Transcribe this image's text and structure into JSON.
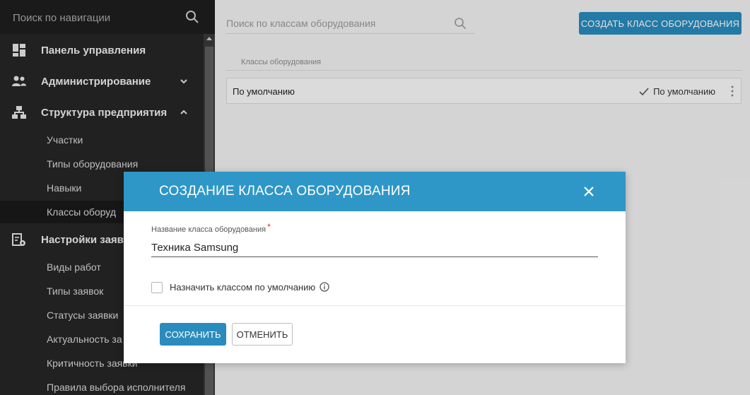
{
  "sidebar": {
    "search_placeholder": "Поиск по навигации",
    "items": [
      {
        "label": "Панель управления",
        "icon": "dashboard-icon"
      },
      {
        "label": "Администрирование",
        "icon": "users-icon",
        "chevron": "down"
      },
      {
        "label": "Структура предприятия",
        "icon": "org-structure-icon",
        "chevron": "up"
      }
    ],
    "structure_sub": [
      "Участки",
      "Типы оборудования",
      "Навыки",
      "Классы оборуд"
    ],
    "settings": {
      "label": "Настройки заяв",
      "icon": "settings-clipboard-icon"
    },
    "settings_sub": [
      "Виды работ",
      "Типы заявок",
      "Статусы заявки",
      "Актуальность за",
      "Критичность заявки",
      "Правила выбора исполнителя"
    ]
  },
  "main": {
    "search_placeholder": "Поиск по классам оборудования",
    "create_button": "СОЗДАТЬ КЛАСС ОБОРУДОВАНИЯ",
    "column_header": "Классы оборудования",
    "rows": [
      {
        "name": "По умолчанию",
        "default_label": "По умолчанию"
      }
    ]
  },
  "modal": {
    "title": "СОЗДАНИЕ КЛАССА ОБОРУДОВАНИЯ",
    "field_label": "Название класса оборудования",
    "required_mark": "*",
    "field_value": "Техника Samsung",
    "checkbox_label": "Назначить классом по умолчанию",
    "checkbox_checked": false,
    "save_button": "СОХРАНИТЬ",
    "cancel_button": "ОТМЕНИТЬ"
  },
  "colors": {
    "sidebar_bg": "#262626",
    "accent": "#2a8bbd",
    "modal_header": "#2e97c7",
    "required": "#d62a2a"
  }
}
